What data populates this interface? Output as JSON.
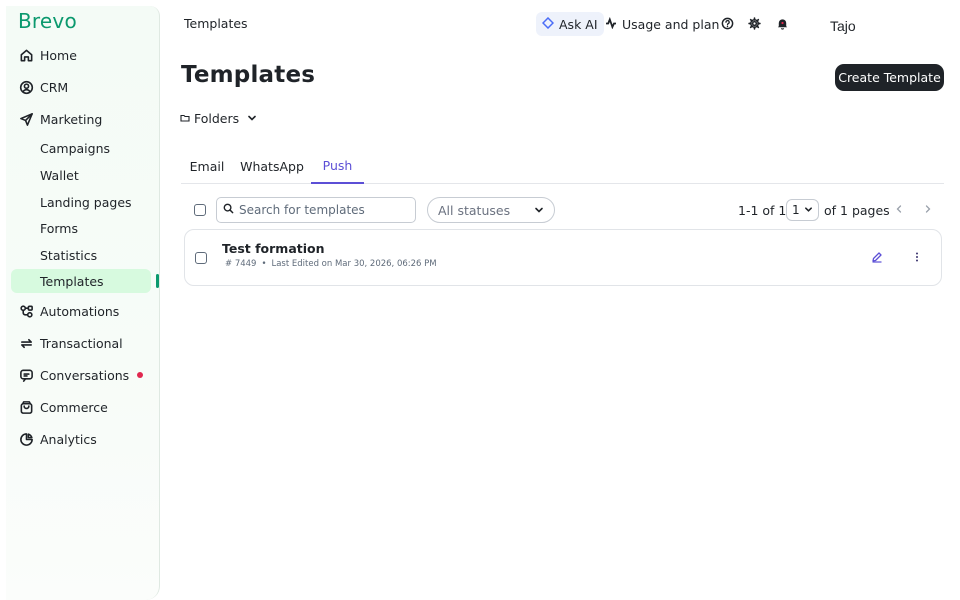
{
  "brand": {
    "logo_text": "Brevo",
    "accent": "#0b996e",
    "active_bg": "#d7fadf",
    "notification_dot": "#e0284f"
  },
  "sidebar": {
    "items": [
      {
        "label": "Home",
        "icon": "home-icon"
      },
      {
        "label": "CRM",
        "icon": "user-circle-icon"
      },
      {
        "label": "Marketing",
        "icon": "paper-plane-icon"
      },
      {
        "label": "Automations",
        "icon": "workflow-icon"
      },
      {
        "label": "Transactional",
        "icon": "swap-arrows-icon"
      },
      {
        "label": "Conversations",
        "icon": "chat-icon",
        "has_notification": true
      },
      {
        "label": "Commerce",
        "icon": "shopping-bag-icon"
      },
      {
        "label": "Analytics",
        "icon": "pie-chart-icon"
      }
    ],
    "marketing_sub": [
      {
        "label": "Campaigns"
      },
      {
        "label": "Wallet"
      },
      {
        "label": "Landing pages"
      },
      {
        "label": "Forms"
      },
      {
        "label": "Statistics"
      },
      {
        "label": "Templates",
        "active": true
      }
    ]
  },
  "topbar": {
    "breadcrumb": "Templates",
    "ask_ai_label": "Ask AI",
    "usage_label": "Usage and plan",
    "user_name": "Tajo",
    "icons": [
      "help-icon",
      "gear-icon",
      "bell-icon"
    ]
  },
  "page": {
    "title": "Templates",
    "create_label": "Create Template",
    "folders_label": "Folders"
  },
  "tabs": [
    {
      "label": "Email"
    },
    {
      "label": "WhatsApp"
    },
    {
      "label": "Push",
      "active": true
    }
  ],
  "filters": {
    "search_placeholder": "Search for templates",
    "status_value": "All statuses"
  },
  "pagination": {
    "range_label": "1-1 of 1",
    "current_page": "1",
    "total_label": "of 1 pages"
  },
  "templates": [
    {
      "name": "Test formation",
      "id_label": "# 7449",
      "separator": "•",
      "edited_label": "Last Edited on Mar 30, 2026, 06:26 PM"
    }
  ],
  "colors": {
    "tab_active": "#5c4fd6",
    "primary_button": "#1f2328"
  }
}
